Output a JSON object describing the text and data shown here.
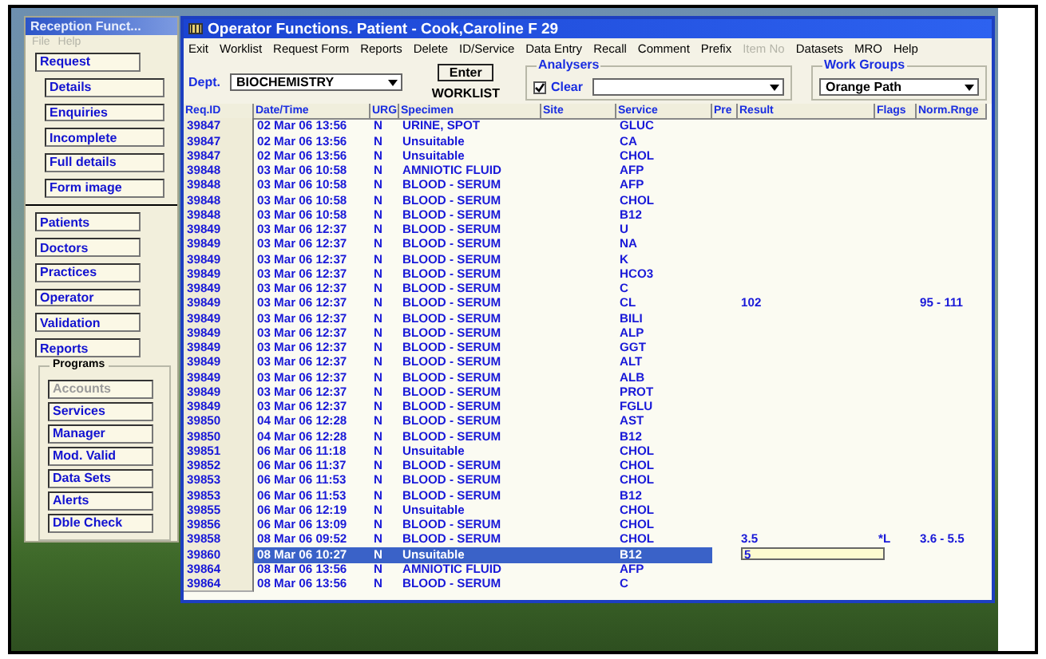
{
  "reception": {
    "title": "Reception Funct...",
    "menu": [
      {
        "label": "File",
        "disabled": true
      },
      {
        "label": "Help",
        "disabled": true
      }
    ],
    "request_buttons": [
      {
        "label": "Request",
        "sub": false
      },
      {
        "label": "Details",
        "sub": true
      },
      {
        "label": "Enquiries",
        "sub": true
      },
      {
        "label": "Incomplete",
        "sub": true
      },
      {
        "label": "Full details",
        "sub": true
      },
      {
        "label": "Form image",
        "sub": true
      }
    ],
    "main_buttons": [
      "Patients",
      "Doctors",
      "Practices",
      "Operator",
      "Validation",
      "Reports"
    ],
    "programs": {
      "title": "Programs",
      "buttons": [
        {
          "label": "Accounts",
          "disabled": true
        },
        {
          "label": "Services",
          "disabled": false
        },
        {
          "label": "Manager",
          "disabled": false
        },
        {
          "label": "Mod. Valid",
          "disabled": false
        },
        {
          "label": "Data Sets",
          "disabled": false
        },
        {
          "label": "Alerts",
          "disabled": false
        },
        {
          "label": "Dble Check",
          "disabled": false
        }
      ]
    }
  },
  "window": {
    "title": "Operator Functions. Patient - Cook,Caroline F 29"
  },
  "menu": [
    {
      "label": "Exit",
      "disabled": false
    },
    {
      "label": "Worklist",
      "disabled": false
    },
    {
      "label": "Request Form",
      "disabled": false
    },
    {
      "label": "Reports",
      "disabled": false
    },
    {
      "label": "Delete",
      "disabled": false
    },
    {
      "label": "ID/Service",
      "disabled": false
    },
    {
      "label": "Data Entry",
      "disabled": false
    },
    {
      "label": "Recall",
      "disabled": false
    },
    {
      "label": "Comment",
      "disabled": false
    },
    {
      "label": "Prefix",
      "disabled": false
    },
    {
      "label": "Item No",
      "disabled": true
    },
    {
      "label": "Datasets",
      "disabled": false
    },
    {
      "label": "MRO",
      "disabled": false
    },
    {
      "label": "Help",
      "disabled": false
    }
  ],
  "toolbar": {
    "dept_label": "Dept.",
    "dept_value": "BIOCHEMISTRY",
    "enter_button": "Enter",
    "worklist_label": "WORKLIST",
    "analysers": {
      "title": "Analysers",
      "clear_label": "Clear",
      "clear_checked": true
    },
    "work_groups": {
      "title": "Work Groups",
      "value": "Orange Path"
    }
  },
  "table": {
    "columns": [
      "Req.ID",
      "Date/Time",
      "URG",
      "Specimen",
      "Site",
      "Service",
      "Pre",
      "Result",
      "Flags",
      "Norm.Rnge"
    ],
    "rows": [
      {
        "req_id": "39847",
        "date_time": "02 Mar 06 13:56",
        "urg": "N",
        "specimen": "URINE, SPOT",
        "service": "GLUC",
        "selected": false
      },
      {
        "req_id": "39847",
        "date_time": "02 Mar 06 13:56",
        "urg": "N",
        "specimen": "Unsuitable",
        "service": "CA",
        "selected": false
      },
      {
        "req_id": "39847",
        "date_time": "02 Mar 06 13:56",
        "urg": "N",
        "specimen": "Unsuitable",
        "service": "CHOL",
        "selected": false
      },
      {
        "req_id": "39848",
        "date_time": "03 Mar 06 10:58",
        "urg": "N",
        "specimen": "AMNIOTIC FLUID",
        "service": "AFP",
        "selected": false
      },
      {
        "req_id": "39848",
        "date_time": "03 Mar 06 10:58",
        "urg": "N",
        "specimen": "BLOOD - SERUM",
        "service": "AFP",
        "selected": false
      },
      {
        "req_id": "39848",
        "date_time": "03 Mar 06 10:58",
        "urg": "N",
        "specimen": "BLOOD - SERUM",
        "service": "CHOL",
        "selected": false
      },
      {
        "req_id": "39848",
        "date_time": "03 Mar 06 10:58",
        "urg": "N",
        "specimen": "BLOOD - SERUM",
        "service": "B12",
        "selected": false
      },
      {
        "req_id": "39849",
        "date_time": "03 Mar 06 12:37",
        "urg": "N",
        "specimen": "BLOOD - SERUM",
        "service": "U",
        "selected": false
      },
      {
        "req_id": "39849",
        "date_time": "03 Mar 06 12:37",
        "urg": "N",
        "specimen": "BLOOD - SERUM",
        "service": "NA",
        "selected": false
      },
      {
        "req_id": "39849",
        "date_time": "03 Mar 06 12:37",
        "urg": "N",
        "specimen": "BLOOD - SERUM",
        "service": "K",
        "selected": false
      },
      {
        "req_id": "39849",
        "date_time": "03 Mar 06 12:37",
        "urg": "N",
        "specimen": "BLOOD - SERUM",
        "service": "HCO3",
        "selected": false
      },
      {
        "req_id": "39849",
        "date_time": "03 Mar 06 12:37",
        "urg": "N",
        "specimen": "BLOOD - SERUM",
        "service": "C",
        "selected": false
      },
      {
        "req_id": "39849",
        "date_time": "03 Mar 06 12:37",
        "urg": "N",
        "specimen": "BLOOD - SERUM",
        "service": "CL",
        "result": "102",
        "norm_range": "95 - 111",
        "selected": false
      },
      {
        "req_id": "39849",
        "date_time": "03 Mar 06 12:37",
        "urg": "N",
        "specimen": "BLOOD - SERUM",
        "service": "BILI",
        "selected": false
      },
      {
        "req_id": "39849",
        "date_time": "03 Mar 06 12:37",
        "urg": "N",
        "specimen": "BLOOD - SERUM",
        "service": "ALP",
        "selected": false
      },
      {
        "req_id": "39849",
        "date_time": "03 Mar 06 12:37",
        "urg": "N",
        "specimen": "BLOOD - SERUM",
        "service": "GGT",
        "selected": false
      },
      {
        "req_id": "39849",
        "date_time": "03 Mar 06 12:37",
        "urg": "N",
        "specimen": "BLOOD - SERUM",
        "service": "ALT",
        "selected": false
      },
      {
        "req_id": "39849",
        "date_time": "03 Mar 06 12:37",
        "urg": "N",
        "specimen": "BLOOD - SERUM",
        "service": "ALB",
        "selected": false
      },
      {
        "req_id": "39849",
        "date_time": "03 Mar 06 12:37",
        "urg": "N",
        "specimen": "BLOOD - SERUM",
        "service": "PROT",
        "selected": false
      },
      {
        "req_id": "39849",
        "date_time": "03 Mar 06 12:37",
        "urg": "N",
        "specimen": "BLOOD - SERUM",
        "service": "FGLU",
        "selected": false
      },
      {
        "req_id": "39850",
        "date_time": "04 Mar 06 12:28",
        "urg": "N",
        "specimen": "BLOOD - SERUM",
        "service": "AST",
        "selected": false
      },
      {
        "req_id": "39850",
        "date_time": "04 Mar 06 12:28",
        "urg": "N",
        "specimen": "BLOOD - SERUM",
        "service": "B12",
        "selected": false
      },
      {
        "req_id": "39851",
        "date_time": "06 Mar 06 11:18",
        "urg": "N",
        "specimen": "Unsuitable",
        "service": "CHOL",
        "selected": false
      },
      {
        "req_id": "39852",
        "date_time": "06 Mar 06 11:37",
        "urg": "N",
        "specimen": "BLOOD - SERUM",
        "service": "CHOL",
        "selected": false
      },
      {
        "req_id": "39853",
        "date_time": "06 Mar 06 11:53",
        "urg": "N",
        "specimen": "BLOOD - SERUM",
        "service": "CHOL",
        "selected": false
      },
      {
        "req_id": "39853",
        "date_time": "06 Mar 06 11:53",
        "urg": "N",
        "specimen": "BLOOD - SERUM",
        "service": "B12",
        "selected": false
      },
      {
        "req_id": "39855",
        "date_time": "06 Mar 06 12:19",
        "urg": "N",
        "specimen": "Unsuitable",
        "service": "CHOL",
        "selected": false
      },
      {
        "req_id": "39856",
        "date_time": "06 Mar 06 13:09",
        "urg": "N",
        "specimen": "BLOOD - SERUM",
        "service": "CHOL",
        "selected": false
      },
      {
        "req_id": "39858",
        "date_time": "08 Mar 06 09:52",
        "urg": "N",
        "specimen": "BLOOD - SERUM",
        "service": "CHOL",
        "result": "3.5",
        "flags": "*L",
        "norm_range": "3.6 - 5.5",
        "selected": false
      },
      {
        "req_id": "39860",
        "date_time": "08 Mar 06 10:27",
        "urg": "N",
        "specimen": "Unsuitable",
        "service": "B12",
        "result_input": "5",
        "selected": true
      },
      {
        "req_id": "39864",
        "date_time": "08 Mar 06 13:56",
        "urg": "N",
        "specimen": "AMNIOTIC FLUID",
        "service": "AFP",
        "selected": false
      },
      {
        "req_id": "39864",
        "date_time": "08 Mar 06 13:56",
        "urg": "N",
        "specimen": "BLOOD - SERUM",
        "service": "C",
        "selected": false
      }
    ]
  }
}
